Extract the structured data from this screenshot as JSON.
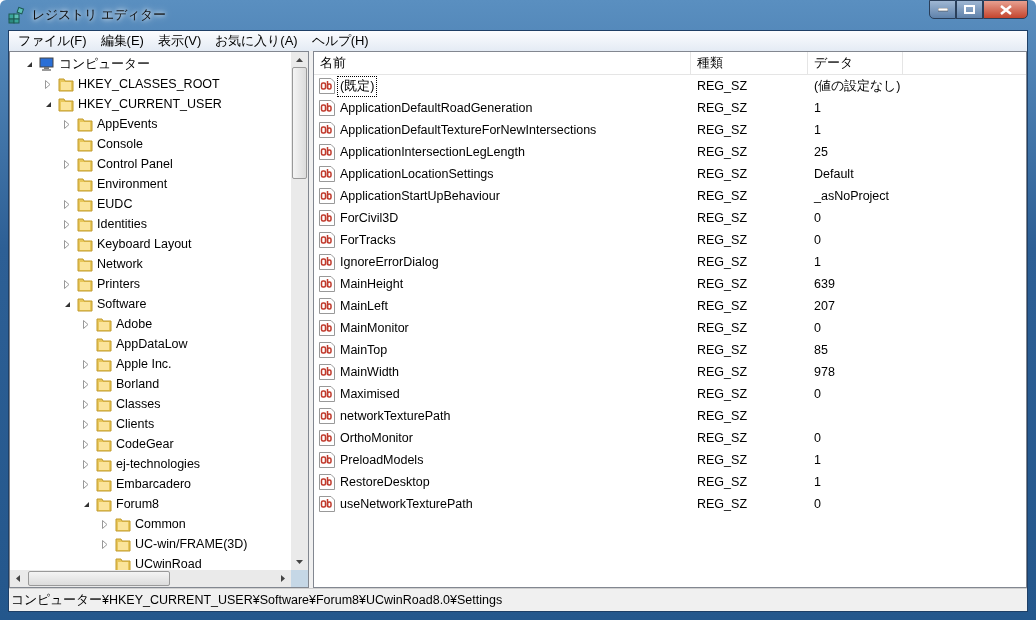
{
  "window": {
    "title": "レジストリ エディター"
  },
  "menu": [
    "ファイル(F)",
    "編集(E)",
    "表示(V)",
    "お気に入り(A)",
    "ヘルプ(H)"
  ],
  "tree": {
    "label": "コンピューター",
    "kind": "computer",
    "expanded": true,
    "children": [
      {
        "label": "HKEY_CLASSES_ROOT",
        "kind": "branch",
        "expanded": false
      },
      {
        "label": "HKEY_CURRENT_USER",
        "kind": "branch",
        "expanded": true,
        "children": [
          {
            "label": "AppEvents",
            "kind": "branch",
            "expanded": false
          },
          {
            "label": "Console",
            "kind": "leaf"
          },
          {
            "label": "Control Panel",
            "kind": "branch",
            "expanded": false
          },
          {
            "label": "Environment",
            "kind": "leaf"
          },
          {
            "label": "EUDC",
            "kind": "branch",
            "expanded": false
          },
          {
            "label": "Identities",
            "kind": "branch",
            "expanded": false
          },
          {
            "label": "Keyboard Layout",
            "kind": "branch",
            "expanded": false
          },
          {
            "label": "Network",
            "kind": "leaf"
          },
          {
            "label": "Printers",
            "kind": "branch",
            "expanded": false
          },
          {
            "label": "Software",
            "kind": "branch",
            "expanded": true,
            "children": [
              {
                "label": "Adobe",
                "kind": "branch",
                "expanded": false
              },
              {
                "label": "AppDataLow",
                "kind": "leaf"
              },
              {
                "label": "Apple Inc.",
                "kind": "branch",
                "expanded": false
              },
              {
                "label": "Borland",
                "kind": "branch",
                "expanded": false
              },
              {
                "label": "Classes",
                "kind": "branch",
                "expanded": false
              },
              {
                "label": "Clients",
                "kind": "branch",
                "expanded": false
              },
              {
                "label": "CodeGear",
                "kind": "branch",
                "expanded": false
              },
              {
                "label": "ej-technologies",
                "kind": "branch",
                "expanded": false
              },
              {
                "label": "Embarcadero",
                "kind": "branch",
                "expanded": false
              },
              {
                "label": "Forum8",
                "kind": "branch",
                "expanded": true,
                "children": [
                  {
                    "label": "Common",
                    "kind": "branch",
                    "expanded": false
                  },
                  {
                    "label": "UC-win/FRAME(3D)",
                    "kind": "branch",
                    "expanded": false
                  },
                  {
                    "label": "UCwinRoad",
                    "kind": "leaf"
                  }
                ]
              }
            ]
          }
        ]
      }
    ]
  },
  "table": {
    "columns": [
      "名前",
      "種類",
      "データ"
    ],
    "rows": [
      {
        "name": "(既定)",
        "type": "REG_SZ",
        "data": "(値の設定なし)",
        "focused": true
      },
      {
        "name": "ApplicationDefaultRoadGeneration",
        "type": "REG_SZ",
        "data": "1",
        "focused": false
      },
      {
        "name": "ApplicationDefaultTextureForNewIntersections",
        "type": "REG_SZ",
        "data": "1",
        "focused": false
      },
      {
        "name": "ApplicationIntersectionLegLength",
        "type": "REG_SZ",
        "data": "25",
        "focused": false
      },
      {
        "name": "ApplicationLocationSettings",
        "type": "REG_SZ",
        "data": "Default",
        "focused": false
      },
      {
        "name": "ApplicationStartUpBehaviour",
        "type": "REG_SZ",
        "data": "_asNoProject",
        "focused": false
      },
      {
        "name": "ForCivil3D",
        "type": "REG_SZ",
        "data": "0",
        "focused": false
      },
      {
        "name": "ForTracks",
        "type": "REG_SZ",
        "data": "0",
        "focused": false
      },
      {
        "name": "IgnoreErrorDialog",
        "type": "REG_SZ",
        "data": "1",
        "focused": false
      },
      {
        "name": "MainHeight",
        "type": "REG_SZ",
        "data": "639",
        "focused": false
      },
      {
        "name": "MainLeft",
        "type": "REG_SZ",
        "data": "207",
        "focused": false
      },
      {
        "name": "MainMonitor",
        "type": "REG_SZ",
        "data": "0",
        "focused": false
      },
      {
        "name": "MainTop",
        "type": "REG_SZ",
        "data": "85",
        "focused": false
      },
      {
        "name": "MainWidth",
        "type": "REG_SZ",
        "data": "978",
        "focused": false
      },
      {
        "name": "Maximised",
        "type": "REG_SZ",
        "data": "0",
        "focused": false
      },
      {
        "name": "networkTexturePath",
        "type": "REG_SZ",
        "focused": false
      },
      {
        "name": "OrthoMonitor",
        "type": "REG_SZ",
        "data": "0",
        "focused": false
      },
      {
        "name": "PreloadModels",
        "type": "REG_SZ",
        "data": "1",
        "focused": false
      },
      {
        "name": "RestoreDesktop",
        "type": "REG_SZ",
        "data": "1",
        "focused": false
      },
      {
        "name": "useNetworkTexturePath",
        "type": "REG_SZ",
        "data": "0",
        "focused": false
      }
    ]
  },
  "status_bar": "コンピューター¥HKEY_CURRENT_USER¥Software¥Forum8¥UCwinRoad8.0¥Settings"
}
